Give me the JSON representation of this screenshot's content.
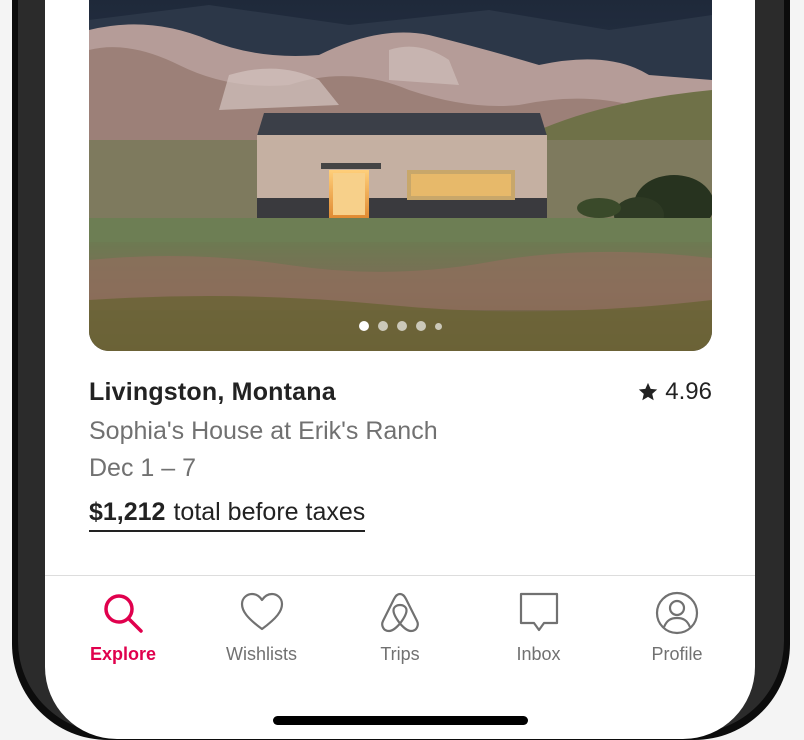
{
  "listing": {
    "location": "Livingston, Montana",
    "rating": "4.96",
    "title": "Sophia's House at Erik's Ranch",
    "dates": "Dec 1 – 7",
    "price": "$1,212",
    "price_suffix": "total before taxes",
    "photo_dots": {
      "count": 5,
      "active_index": 0
    }
  },
  "tabbar": {
    "tabs": [
      {
        "label": "Explore",
        "icon": "search-icon",
        "active": true
      },
      {
        "label": "Wishlists",
        "icon": "heart-icon",
        "active": false
      },
      {
        "label": "Trips",
        "icon": "airbnb-logo-icon",
        "active": false
      },
      {
        "label": "Inbox",
        "icon": "message-icon",
        "active": false
      },
      {
        "label": "Profile",
        "icon": "user-circle-icon",
        "active": false
      }
    ]
  },
  "colors": {
    "accent": "#e0004d",
    "text_primary": "#222222",
    "text_secondary": "#717171"
  }
}
